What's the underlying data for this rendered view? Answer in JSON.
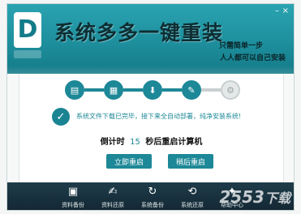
{
  "header": {
    "logo_letter": "D",
    "title": "系统多多一键重装",
    "slogan_line1": "只需简单一步",
    "slogan_line2": "人人都可以自己安装"
  },
  "window_controls": {
    "minimize": "–",
    "close": "×"
  },
  "steps": [
    {
      "icon": "document-icon",
      "glyph": "▤",
      "active": true
    },
    {
      "icon": "clipboard-icon",
      "glyph": "▦",
      "active": true
    },
    {
      "icon": "download-icon",
      "glyph": "⬇",
      "active": true
    },
    {
      "icon": "install-icon",
      "glyph": "✎",
      "active": true
    },
    {
      "icon": "gear-icon",
      "glyph": "⚙",
      "active": false
    }
  ],
  "status": {
    "check_glyph": "✓",
    "message": "系统文件下载已完毕，接下来全自动部署，纯净安装系统!"
  },
  "countdown": {
    "prefix": "倒计时",
    "seconds": "15",
    "suffix": "秒后重启计算机"
  },
  "buttons": {
    "restart_now": "立即重启",
    "restart_later": "稍后重启"
  },
  "toolbar": [
    {
      "icon": "contacts-icon",
      "glyph": "▣",
      "label": "资料备份"
    },
    {
      "icon": "record-icon",
      "glyph": "✍",
      "label": "资料还原"
    },
    {
      "icon": "refresh-icon",
      "glyph": "↻",
      "label": "系统备份"
    },
    {
      "icon": "restore-icon",
      "glyph": "⟲",
      "label": "系统还原"
    },
    {
      "icon": "bulb-icon",
      "glyph": "✦",
      "label": "帮助中心"
    }
  ],
  "watermark": {
    "text": "2553",
    "suffix": "下载"
  },
  "colors": {
    "accent": "#1d8897",
    "header": "#1d8d9b",
    "footer": "#132733"
  }
}
